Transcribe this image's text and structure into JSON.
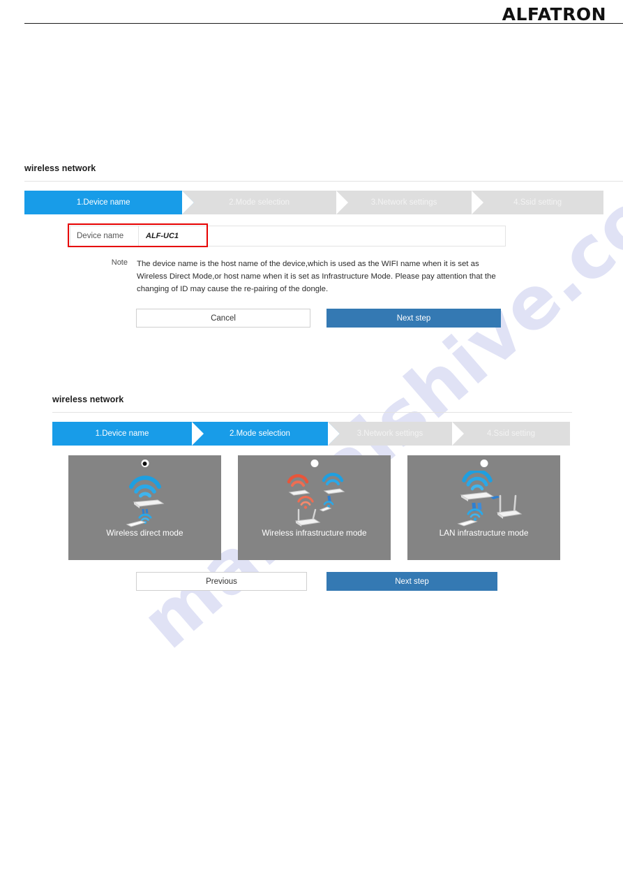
{
  "header": {
    "brand": "ALFATRON"
  },
  "watermark": {
    "text": "manualshive.com"
  },
  "colors": {
    "step_active": "#189ce8",
    "step_inactive": "#dedede",
    "primary_button": "#3479b3",
    "card_background": "#848484",
    "highlight_box": "#e60000"
  },
  "section_one": {
    "title": "wireless network",
    "steps": [
      {
        "label": "1.Device name",
        "state": "active"
      },
      {
        "label": "2.Mode selection",
        "state": "inactive"
      },
      {
        "label": "3.Network settings",
        "state": "inactive"
      },
      {
        "label": "4.Ssid setting",
        "state": "inactive"
      }
    ],
    "field": {
      "label": "Device name",
      "value": "ALF-UC1"
    },
    "note": {
      "label": "Note",
      "text": "The device name is the host name of the device,which is used as the WIFI name when it is set as Wireless Direct Mode,or host name when it is set as Infrastructure Mode. Please pay attention that the changing of ID may cause the re-pairing of the dongle."
    },
    "buttons": {
      "cancel": "Cancel",
      "next": "Next step"
    }
  },
  "section_two": {
    "title": "wireless network",
    "steps": [
      {
        "label": "1.Device name",
        "state": "active"
      },
      {
        "label": "2.Mode selection",
        "state": "active"
      },
      {
        "label": "3.Network settings",
        "state": "inactive"
      },
      {
        "label": "4.Ssid setting",
        "state": "inactive"
      }
    ],
    "modes": [
      {
        "label": "Wireless direct mode",
        "selected": true
      },
      {
        "label": "Wireless infrastructure mode",
        "selected": false
      },
      {
        "label": "LAN infrastructure mode",
        "selected": false
      }
    ],
    "buttons": {
      "previous": "Previous",
      "next": "Next step"
    }
  }
}
